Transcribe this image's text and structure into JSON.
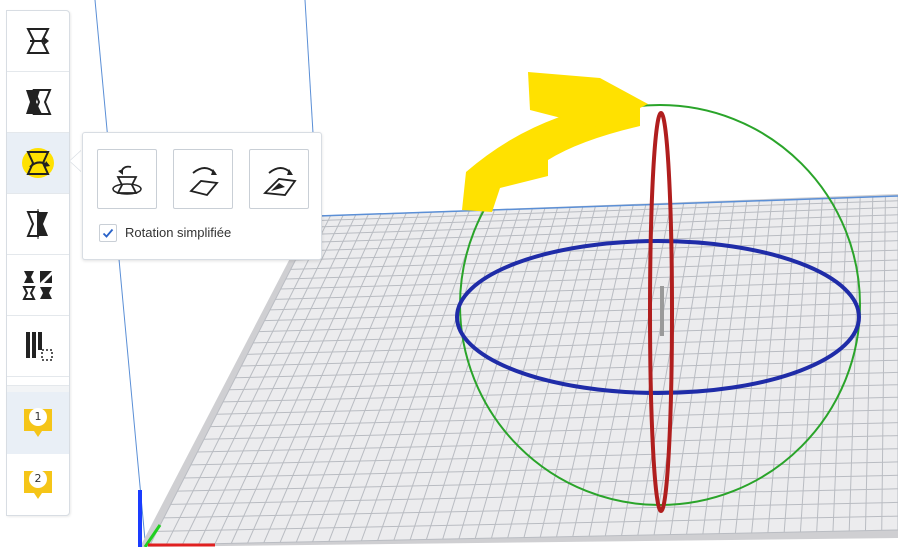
{
  "toolbar": {
    "tools": [
      {
        "name": "move-tool",
        "icon": "move-icon"
      },
      {
        "name": "scale-tool",
        "icon": "scale-icon"
      },
      {
        "name": "rotate-tool",
        "icon": "rotate-icon",
        "active": true
      },
      {
        "name": "mirror-tool",
        "icon": "mirror-icon"
      },
      {
        "name": "per-model-settings-tool",
        "icon": "per-model-settings-icon"
      },
      {
        "name": "support-blocker-tool",
        "icon": "support-blocker-icon"
      }
    ],
    "extruders": [
      {
        "number": "1"
      },
      {
        "number": "2"
      }
    ]
  },
  "rotate_panel": {
    "buttons": [
      "reset-rotation",
      "lay-flat",
      "select-face-to-align"
    ],
    "checkbox_label": "Rotation simplifiée",
    "checkbox_checked": true
  },
  "colors": {
    "accent": "#ffe100",
    "ring_red": "#b01e1e",
    "ring_green": "#2aa42a",
    "ring_blue": "#1f2ca8",
    "grid": "#b9bcc2",
    "plate": "#ececee",
    "extruder_badge": "#f5c518"
  }
}
